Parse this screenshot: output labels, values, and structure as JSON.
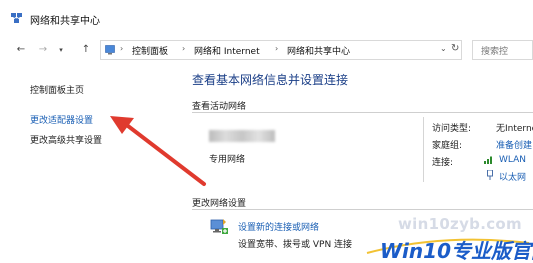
{
  "window": {
    "title": "网络和共享中心"
  },
  "nav": {
    "back_icon": "arrow-left-icon",
    "forward_icon": "arrow-right-icon",
    "up_icon": "arrow-up-icon"
  },
  "address_bar": {
    "breadcrumbs": [
      "控制面板",
      "网络和 Internet",
      "网络和共享中心"
    ],
    "refresh_icon": "refresh-icon"
  },
  "search": {
    "placeholder": "搜索控"
  },
  "sidebar": {
    "items": [
      {
        "label": "控制面板主页"
      },
      {
        "label": "更改适配器设置"
      },
      {
        "label": "更改高级共享设置"
      }
    ]
  },
  "main": {
    "title": "查看基本网络信息并设置连接",
    "active_networks": {
      "heading": "查看活动网络",
      "network_type": "专用网络",
      "fields": [
        {
          "label": "访问类型:",
          "value": "无Internet"
        },
        {
          "label": "家庭组:",
          "value": "准备创建"
        },
        {
          "label": "连接:",
          "value": "WLAN"
        },
        {
          "label": "",
          "value": "以太网"
        }
      ]
    },
    "change_settings": {
      "heading": "更改网络设置",
      "setup_link": "设置新的连接或网络",
      "setup_desc": "设置宽带、拨号或 VPN 连接"
    }
  },
  "watermark": {
    "url": "win10zyb.com",
    "brand": "Win10",
    "brand_suffix": "专业版官网"
  },
  "colors": {
    "link": "#1a5fb4",
    "title": "#1a3e87",
    "arrow": "#e03a2e",
    "brand": "#1b5cc8"
  }
}
